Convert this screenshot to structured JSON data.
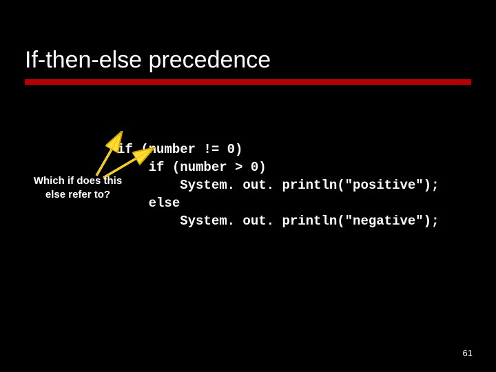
{
  "title": "If-then-else precedence",
  "code": {
    "l1": "if (number != 0)",
    "l2": "    if (number > 0)",
    "l3": "        System. out. println(\"positive\");",
    "l4": "    else",
    "l5": "        System. out. println(\"negative\");"
  },
  "annotation": {
    "line1": "Which if does this",
    "line2": "else refer to?"
  },
  "page_number": "61",
  "colors": {
    "accent_red": "#b40000",
    "arrow_fill": "#ffdd33",
    "arrow_stroke": "#caa400"
  }
}
